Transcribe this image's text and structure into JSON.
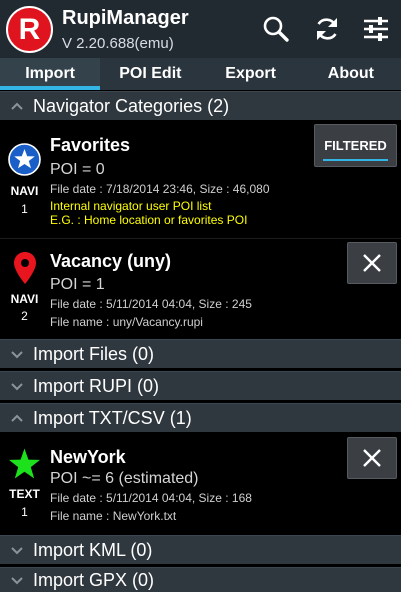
{
  "app": {
    "title": "RupiManager",
    "version": "V 2.20.688(emu)",
    "logo_letter": "R"
  },
  "tabs": [
    {
      "label": "Import",
      "active": true
    },
    {
      "label": "POI Edit",
      "active": false
    },
    {
      "label": "Export",
      "active": false
    },
    {
      "label": "About",
      "active": false
    }
  ],
  "sections": {
    "navigator": {
      "label": "Navigator Categories (2)",
      "expanded": true
    },
    "import_files": {
      "label": "Import Files (0)",
      "expanded": false
    },
    "import_rupi": {
      "label": "Import RUPI (0)",
      "expanded": false
    },
    "import_txt": {
      "label": "Import TXT/CSV (1)",
      "expanded": true
    },
    "import_kml": {
      "label": "Import KML (0)",
      "expanded": false
    },
    "import_gpx": {
      "label": "Import GPX (0)",
      "expanded": false
    }
  },
  "cards": {
    "favorites": {
      "icon": "star-icon",
      "type": "NAVI",
      "num": "1",
      "name": "Favorites",
      "poi": "POI = 0",
      "file_date": "File date : 7/18/2014 23:46, Size : 46,080",
      "desc1": "Internal navigator user POI list",
      "desc2": "E.G. : Home location or favorites POI",
      "button": "FILTERED"
    },
    "vacancy": {
      "icon": "map-pin-icon",
      "type": "NAVI",
      "num": "2",
      "name": "Vacancy (uny)",
      "poi": "POI = 1",
      "file_date": "File date : 5/11/2014 04:04, Size : 245",
      "file_name": "File name : uny/Vacancy.rupi"
    },
    "newyork": {
      "icon": "star-icon",
      "type": "TEXT",
      "num": "1",
      "name": "NewYork",
      "poi": "POI ~= 6 (estimated)",
      "file_date": "File date : 5/11/2014 04:04, Size : 168",
      "file_name": "File name : NewYork.txt"
    }
  },
  "colors": {
    "accent": "#33b5e5",
    "logo_red": "#e0141e",
    "favorites_star_bg": "#1a5fc8",
    "pin_red": "#e8141e",
    "green_star": "#1ce11c",
    "highlight_text": "#ffff00"
  }
}
